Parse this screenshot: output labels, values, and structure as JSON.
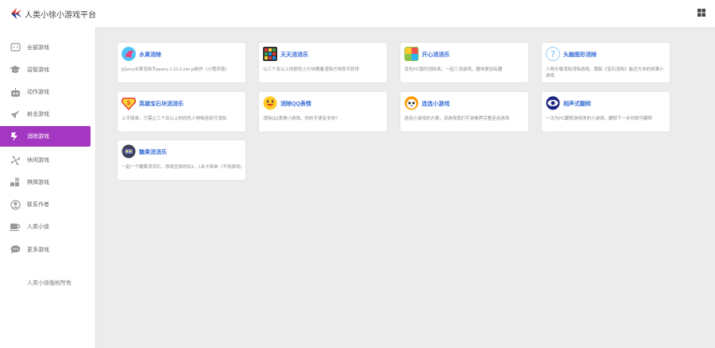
{
  "header": {
    "title": "人类小徐小游戏平台",
    "brand_colors": [
      "#e53935",
      "#1e3a8a"
    ]
  },
  "sidebar": {
    "items": [
      {
        "label": "全部游戏",
        "icon": "chat-icon",
        "active": false
      },
      {
        "label": "益智游戏",
        "icon": "graduation-cap-icon",
        "active": false
      },
      {
        "label": "动作游戏",
        "icon": "robot-icon",
        "active": false
      },
      {
        "label": "射击游戏",
        "icon": "rocket-icon",
        "active": false
      },
      {
        "label": "消除游戏",
        "icon": "puzzle-icon",
        "active": true
      },
      {
        "label": "休闲游戏",
        "icon": "fan-icon",
        "active": false
      },
      {
        "label": "棋牌游戏",
        "icon": "grid-icon",
        "active": false
      },
      {
        "label": "联系作者",
        "icon": "user-icon",
        "active": false
      },
      {
        "label": "人类小徐",
        "icon": "coffee-icon",
        "active": false
      },
      {
        "label": "更多游戏",
        "icon": "bubble-icon",
        "active": false
      }
    ],
    "copyright": "人类小徐版权所有",
    "active_color": "#a437c1"
  },
  "games": [
    {
      "title": "水果消除",
      "desc": "jQuery水果消除手jquery-1.10.2.min.js制作（小程序版）",
      "icon": "fruit-icon"
    },
    {
      "title": "天天消消乐",
      "desc": "以三个及以上的颜色小方块横着消除方块即可获得",
      "icon": "candy-grid-icon"
    },
    {
      "title": "开心消消乐",
      "desc": "变化PC版的消除类，一起三消游戏，趣味更加有趣",
      "icon": "happy-blocks-icon"
    },
    {
      "title": "头脑图形消除",
      "desc": "人物头像消除消除游戏，跟踪《宝石消除》最近方块的效果小游戏",
      "icon": "question-icon"
    },
    {
      "title": "英雄宝石块消消乐",
      "desc": "上手简单，只需让三个及以上的同色人物相连即可消除",
      "icon": "superman-icon"
    },
    {
      "title": "消除QQ表情",
      "desc": "消除QQ表情小游戏，你的手速有多快?",
      "icon": "emoji-icon"
    },
    {
      "title": "连连小游戏",
      "desc": "连连小游戏的方案，该游戏我们手游推荐完整连连游戏",
      "icon": "panda-icon"
    },
    {
      "title": "相声式翻转",
      "desc": "一次为PC翻转游戏类的小游戏，翻转下一步你即可翻转",
      "icon": "eye-icon"
    },
    {
      "title": "糖果消消乐",
      "desc": "一起一个糖果消消乐，游戏全部的玩1，1关卡简单（不用游戏)",
      "icon": "robot-face-icon"
    }
  ]
}
